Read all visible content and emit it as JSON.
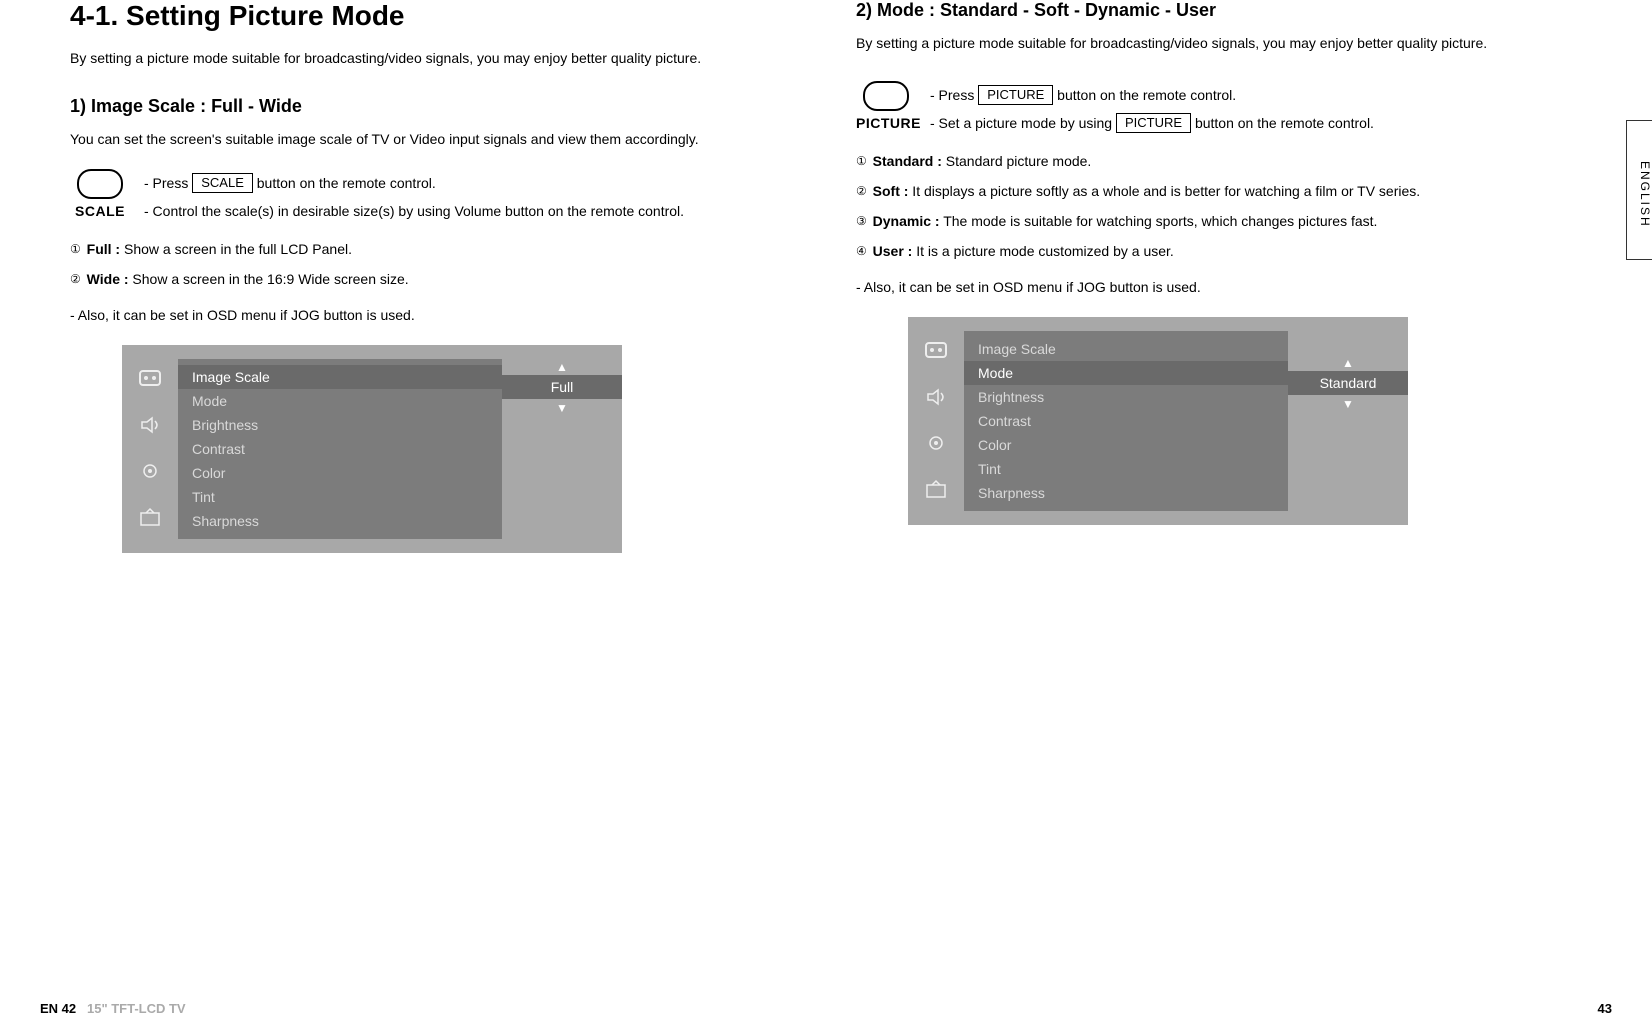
{
  "left": {
    "title": "4-1. Setting Picture Mode",
    "intro": "By setting a picture mode suitable for broadcasting/video signals, you may enjoy better quality picture.",
    "sub1_title": "1) Image Scale : Full - Wide",
    "sub1_desc": "You can set the screen's suitable image scale of TV or Video input signals and view them accordingly.",
    "remote_label": "SCALE",
    "press_prefix": "- Press ",
    "press_btn": "SCALE",
    "press_suffix": " button on the remote control.",
    "press_line2": "- Control the scale(s) in desirable size(s) by using Volume button on the remote control.",
    "items": [
      {
        "n": "①",
        "label": "Full :",
        "desc": " Show a screen in the full LCD Panel."
      },
      {
        "n": "②",
        "label": "Wide :",
        "desc": " Show a screen in the 16:9 Wide screen size."
      }
    ],
    "also": "- Also, it can be set in OSD menu if JOG button is used.",
    "osd": {
      "items": [
        "Image Scale",
        "Mode",
        "Brightness",
        "Contrast",
        "Color",
        "Tint",
        "Sharpness"
      ],
      "selected_index": 0,
      "value": "Full"
    }
  },
  "right": {
    "title": "2) Mode : Standard - Soft - Dynamic - User",
    "intro": "By setting a picture mode suitable for broadcasting/video signals, you may enjoy better quality picture.",
    "remote_label": "PICTURE",
    "press1_prefix": "- Press ",
    "press1_btn": "PICTURE",
    "press1_suffix": " button on the remote control.",
    "press2_prefix": "- Set a picture mode by using ",
    "press2_btn": "PICTURE",
    "press2_suffix": " button on the remote control.",
    "items": [
      {
        "n": "①",
        "label": "Standard :",
        "desc": " Standard picture mode."
      },
      {
        "n": "②",
        "label": "Soft :",
        "desc": " It displays a picture softly as a whole and is better for watching a film or TV series."
      },
      {
        "n": "③",
        "label": "Dynamic :",
        "desc": " The mode is suitable for watching sports, which changes pictures fast."
      },
      {
        "n": "④",
        "label": "User :",
        "desc": " It is a picture mode customized by a user."
      }
    ],
    "also": "- Also, it can be set in OSD menu if JOG button is used.",
    "osd": {
      "items": [
        "Image Scale",
        "Mode",
        "Brightness",
        "Contrast",
        "Color",
        "Tint",
        "Sharpness"
      ],
      "selected_index": 1,
      "value": "Standard"
    }
  },
  "side_tab": "ENGLISH",
  "footer": {
    "left_code": "EN 42",
    "left_model": "15\" TFT-LCD TV",
    "right_page": "43"
  }
}
